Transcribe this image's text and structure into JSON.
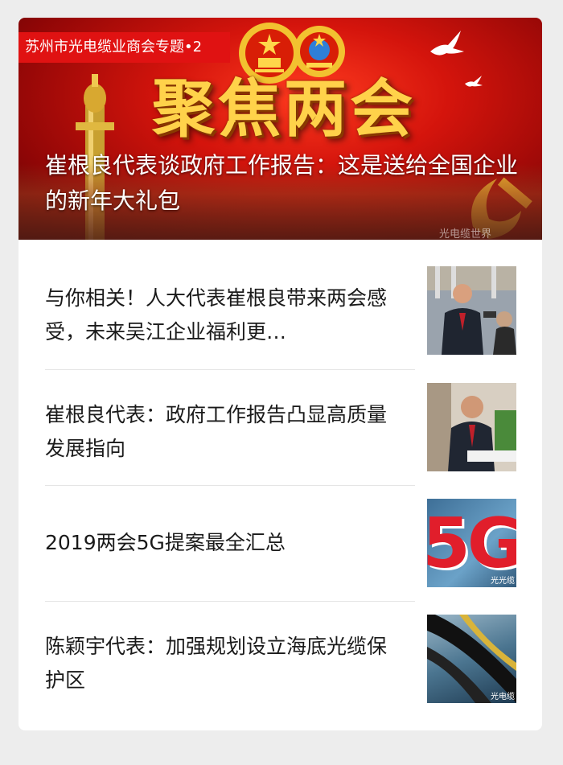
{
  "hero": {
    "tag": "苏州市光电缆业商会专题•2",
    "banner_title": "聚焦两会",
    "headline": "崔根良代表谈政府工作报告：这是送给全国企业的新年大礼包",
    "watermark": "光电缆世界"
  },
  "articles": [
    {
      "title": "与你相关！人大代表崔根良带来两会感受，未来吴江企业福利更…"
    },
    {
      "title": "崔根良代表：政府工作报告凸显高质量发展指向"
    },
    {
      "title": "2019两会5G提案最全汇总"
    },
    {
      "title": "陈颖宇代表：加强规划设立海底光缆保护区"
    }
  ],
  "thumb_texts": {
    "fiveg": "5G",
    "wm3": "光光缆",
    "wm4": "光电缆"
  },
  "colors": {
    "page_bg": "#ededed",
    "card_bg": "#ffffff",
    "tag_red": "#e01212",
    "banner_gold": "#ffd24a"
  }
}
